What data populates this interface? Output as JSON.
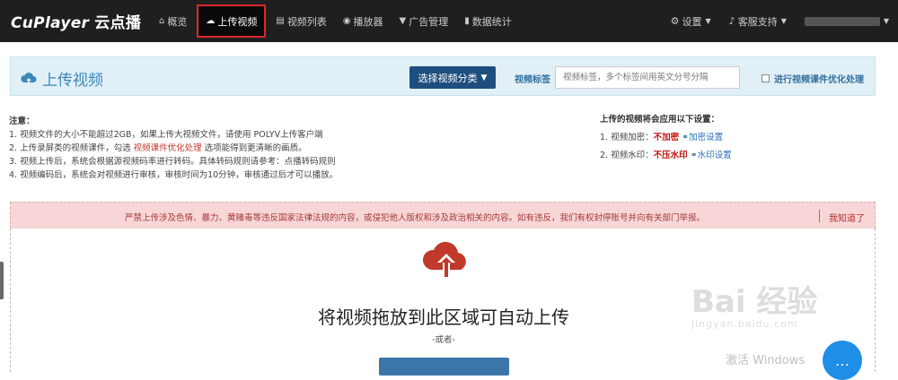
{
  "topbar": {
    "brand": "CuPlayer",
    "brand_cn": "云点播",
    "nav": [
      {
        "label": "概览",
        "icon": "home-icon"
      },
      {
        "label": "上传视频",
        "icon": "cloud-upload-icon",
        "active": true
      },
      {
        "label": "视频列表",
        "icon": "film-icon"
      },
      {
        "label": "播放器",
        "icon": "play-circle-icon"
      },
      {
        "label": "广告管理",
        "icon": "filter-icon"
      },
      {
        "label": "数据统计",
        "icon": "bar-chart-icon"
      }
    ],
    "settings_label": "设置",
    "support_label": "客服支持"
  },
  "header": {
    "title": "上传视频",
    "category_button": "选择视频分类",
    "tag_label": "视频标签",
    "tag_placeholder": "视频标签，多个标签间用英文分号分隔",
    "optimize_label": "进行视频课件优化处理"
  },
  "notes": {
    "title": "注意：",
    "line1": "1. 视频文件的大小不能超过2GB，如果上传大视频文件，请使用 POLYV上传客户端",
    "line2_pre": "2. 上传录屏类的视频课件，勾选",
    "line2_hl": "视频课件优化处理",
    "line2_post": "选项能得到更清晰的画质。",
    "line3": "3. 视频上传后，系统会根据源视频码率进行转码。具体转码规则请参考：点播转码规则",
    "line4": "4. 视频编码后，系统会对视频进行审核，审核时间为10分钟，审核通过后才可以播放。"
  },
  "settings": {
    "title": "上传的视频将会应用以下设置：",
    "encrypt_label": "1. 视频加密：",
    "encrypt_value": "不加密",
    "encrypt_link": "加密设置",
    "watermark_label": "2. 视频水印：",
    "watermark_value": "不压水印",
    "watermark_link": "水印设置"
  },
  "warning": {
    "text": "严禁上传涉及色情、暴力、黄赌毒等违反国家法律法规的内容，或侵犯他人版权和涉及政治相关的内容。如有违反，我们有权封停账号并向有关部门举报。",
    "dismiss": "我知道了"
  },
  "dropzone": {
    "title": "将视频拖放到此区域可自动上传",
    "or": "-或者-"
  },
  "overlay": {
    "watermark_main": "Bai  经验",
    "watermark_sub": "jingyan.baidu.com",
    "activate_text": "激活 Windows"
  },
  "colors": {
    "topbar_bg": "#1f1f1f",
    "active_border": "#e0262d",
    "header_bg": "#e1eff7",
    "primary_button": "#1d4e7e",
    "warning_bg": "#f8d6d7",
    "upload_icon": "#c0392b"
  }
}
